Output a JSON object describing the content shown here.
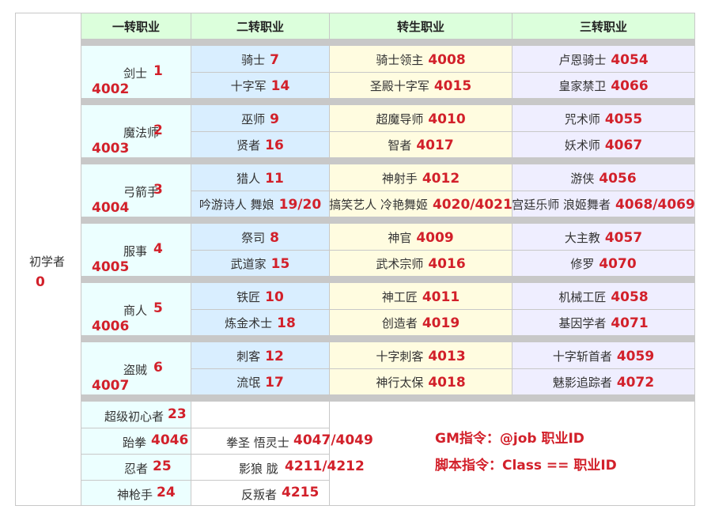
{
  "headers": [
    "一转职业",
    "二转职业",
    "转生职业",
    "三转职业"
  ],
  "novice": {
    "name": "初学者",
    "id": "0"
  },
  "groups": [
    {
      "first": {
        "name": "剑士",
        "id": "1",
        "rebirth_id": "4002"
      },
      "rows": [
        {
          "second": {
            "name": "骑士",
            "id": "7"
          },
          "trans": {
            "name": "骑士领主",
            "id": "4008"
          },
          "third": {
            "name": "卢恩骑士",
            "id": "4054"
          }
        },
        {
          "second": {
            "name": "十字军",
            "id": "14"
          },
          "trans": {
            "name": "圣殿十字军",
            "id": "4015"
          },
          "third": {
            "name": "皇家禁卫",
            "id": "4066"
          }
        }
      ]
    },
    {
      "first": {
        "name": "魔法师",
        "id": "2",
        "rebirth_id": "4003"
      },
      "rows": [
        {
          "second": {
            "name": "巫师",
            "id": "9"
          },
          "trans": {
            "name": "超魔导师",
            "id": "4010"
          },
          "third": {
            "name": "咒术师",
            "id": "4055"
          }
        },
        {
          "second": {
            "name": "贤者",
            "id": "16"
          },
          "trans": {
            "name": "智者",
            "id": "4017"
          },
          "third": {
            "name": "妖术师",
            "id": "4067"
          }
        }
      ]
    },
    {
      "first": {
        "name": "弓箭手",
        "id": "3",
        "rebirth_id": "4004"
      },
      "rows": [
        {
          "second": {
            "name": "猎人",
            "id": "11"
          },
          "trans": {
            "name": "神射手",
            "id": "4012"
          },
          "third": {
            "name": "游侠",
            "id": "4056"
          }
        },
        {
          "second": {
            "name": "吟游诗人 舞娘",
            "id": "19/20"
          },
          "trans": {
            "name": "搞笑艺人 冷艳舞姬",
            "id": "4020/4021"
          },
          "third": {
            "name": "宫廷乐师 浪姬舞者",
            "id": "4068/4069"
          }
        }
      ]
    },
    {
      "first": {
        "name": "服事",
        "id": "4",
        "rebirth_id": "4005"
      },
      "rows": [
        {
          "second": {
            "name": "祭司",
            "id": "8"
          },
          "trans": {
            "name": "神官",
            "id": "4009"
          },
          "third": {
            "name": "大主教",
            "id": "4057"
          }
        },
        {
          "second": {
            "name": "武道家",
            "id": "15"
          },
          "trans": {
            "name": "武术宗师",
            "id": "4016"
          },
          "third": {
            "name": "修罗",
            "id": "4070"
          }
        }
      ]
    },
    {
      "first": {
        "name": "商人",
        "id": "5",
        "rebirth_id": "4006"
      },
      "rows": [
        {
          "second": {
            "name": "铁匠",
            "id": "10"
          },
          "trans": {
            "name": "神工匠",
            "id": "4011"
          },
          "third": {
            "name": "机械工匠",
            "id": "4058"
          }
        },
        {
          "second": {
            "name": "炼金术士",
            "id": "18"
          },
          "trans": {
            "name": "创造者",
            "id": "4019"
          },
          "third": {
            "name": "基因学者",
            "id": "4071"
          }
        }
      ]
    },
    {
      "first": {
        "name": "盗贼",
        "id": "6",
        "rebirth_id": "4007"
      },
      "rows": [
        {
          "second": {
            "name": "刺客",
            "id": "12"
          },
          "trans": {
            "name": "十字刺客",
            "id": "4013"
          },
          "third": {
            "name": "十字斩首者",
            "id": "4059"
          }
        },
        {
          "second": {
            "name": "流氓",
            "id": "17"
          },
          "trans": {
            "name": "神行太保",
            "id": "4018"
          },
          "third": {
            "name": "魅影追踪者",
            "id": "4072"
          }
        }
      ]
    }
  ],
  "extended": [
    {
      "first": {
        "name": "超级初心者",
        "id": "23"
      },
      "second": {
        "name": "",
        "id": ""
      }
    },
    {
      "first": {
        "name": "跆拳",
        "id": "4046"
      },
      "second": {
        "name": "拳圣 悟灵士",
        "id": "4047/4049"
      }
    },
    {
      "first": {
        "name": "忍者",
        "id": "25"
      },
      "second": {
        "name": "影狼 胧",
        "id": "4211/4212"
      }
    },
    {
      "first": {
        "name": "神枪手",
        "id": "24"
      },
      "second": {
        "name": "反叛者",
        "id": "4215"
      }
    }
  ],
  "commands": {
    "gm": "GM指令：@job 职业ID",
    "script": "脚本指令：Class == 职业ID"
  }
}
